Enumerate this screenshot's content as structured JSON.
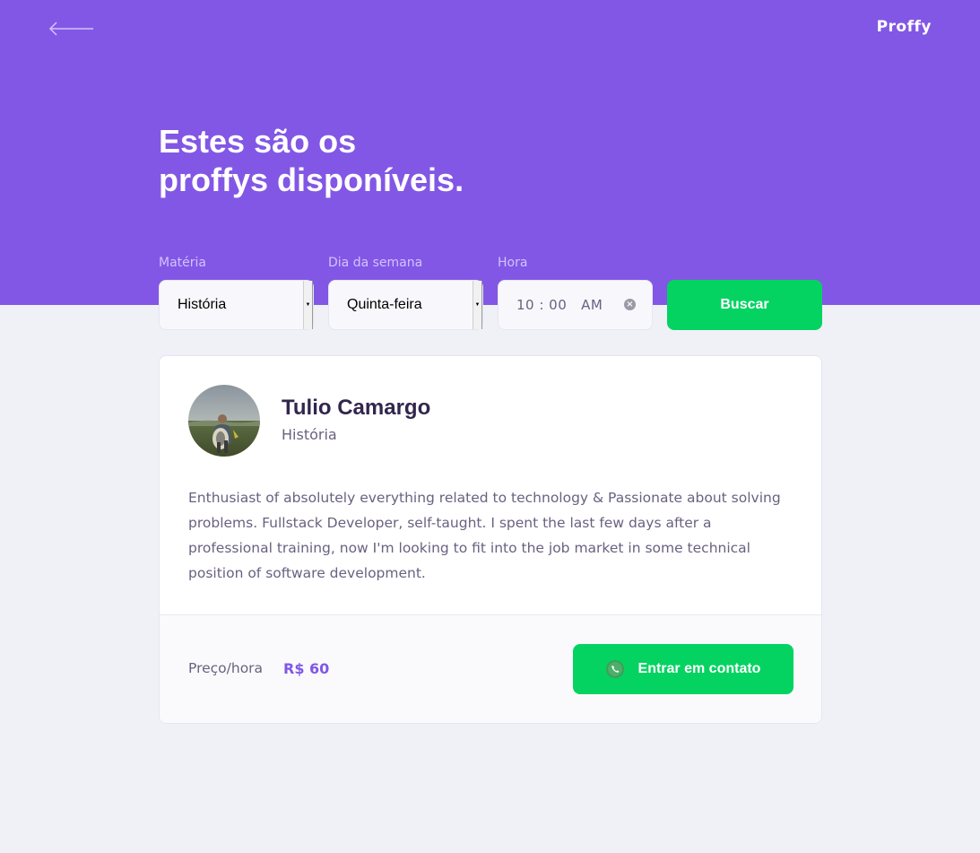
{
  "header": {
    "logo": "Proffy",
    "title_line1": "Estes são os",
    "title_line2": "proffys disponíveis.",
    "back_icon": "arrow-left-icon",
    "background_color": "#8257E5"
  },
  "search_form": {
    "subject": {
      "label": "Matéria",
      "value": "História"
    },
    "week_day": {
      "label": "Dia da semana",
      "value": "Quinta-feira"
    },
    "time": {
      "label": "Hora",
      "value": "10 : 00   AM"
    },
    "submit_label": "Buscar"
  },
  "teacher": {
    "name": "Tulio Camargo",
    "subject": "História",
    "bio": "Enthusiast of absolutely everything related to technology & Passionate about solving problems. Fullstack Developer, self-taught. I spent the last few days after a professional training, now I'm looking to fit into the job market in some technical position of software development.",
    "price_label": "Preço/hora",
    "price_value": "R$ 60",
    "contact_label": "Entrar em contato",
    "contact_icon": "whatsapp-icon"
  },
  "colors": {
    "primary": "#8257E5",
    "secondary": "#04D361",
    "title_text": "#32264D",
    "body_text": "#6A6180",
    "page_background": "#F0F0F7"
  }
}
